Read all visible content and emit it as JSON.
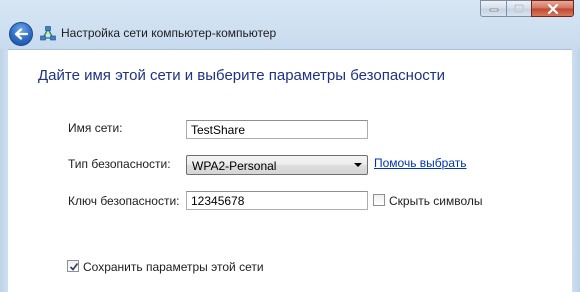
{
  "window": {
    "title": "Настройка сети компьютер-компьютер",
    "icons": {
      "back": "back-arrow-icon",
      "network": "network-icon"
    }
  },
  "page": {
    "heading": "Дайте имя этой сети и выберите параметры безопасности"
  },
  "form": {
    "network_name_label": "Имя сети:",
    "network_name_value": "TestShare",
    "security_type_label": "Тип безопасности:",
    "security_type_value": "WPA2-Personal",
    "help_link": "Помочь выбрать",
    "security_key_label": "Ключ безопасности:",
    "security_key_value": "12345678",
    "hide_chars_label": "Скрыть символы",
    "hide_chars_checked": false,
    "save_settings_label": "Сохранить параметры этой сети",
    "save_settings_checked": true
  },
  "colors": {
    "heading": "#1e3287",
    "link": "#0033bb",
    "frame": "#cfe0f1"
  }
}
